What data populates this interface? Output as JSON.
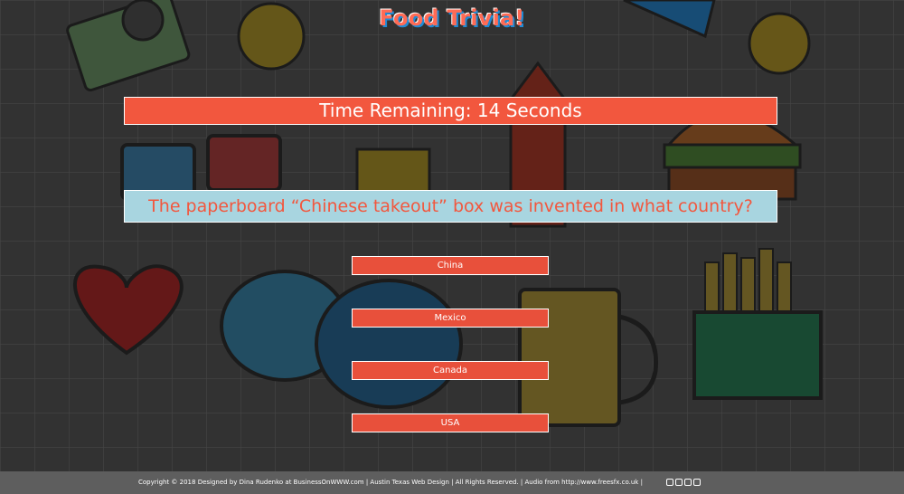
{
  "page": {
    "title": "Food Trivia!",
    "timer_text": "Time Remaining: 14 Seconds",
    "question": "The paperboard “Chinese takeout” box was invented in what country?"
  },
  "answers": [
    "China",
    "Mexico",
    "Canada",
    "USA"
  ],
  "footer": {
    "text": "Copyright © 2018 Designed by Dina Rudenko at BusinessOnWWW.com | Austin Texas Web Design | All Rights Reserved. | Audio from http://www.freesfx.co.uk |",
    "icons": [
      "instagram-icon",
      "linkedin-icon",
      "foursquare-icon",
      "facebook-icon"
    ]
  },
  "colors": {
    "accent": "#f2573e",
    "question_bg": "#a8d5e0",
    "footer_bg": "#5e5e5e",
    "title_shadow": "#1f8bd6"
  }
}
